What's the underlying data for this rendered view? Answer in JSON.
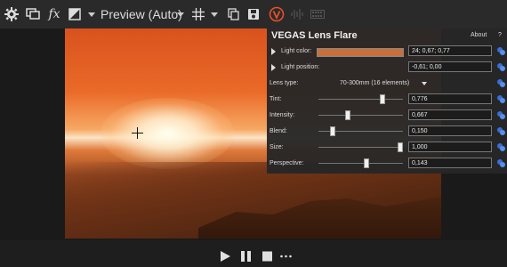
{
  "toolbar": {
    "preview_quality": "Preview (Auto)",
    "icons": [
      "gear-icon",
      "external-monitor-icon",
      "fx-icon",
      "split-screen-icon",
      "grid-overlay-icon",
      "copy-snapshot-icon",
      "save-snapshot-icon",
      "vegas-logo-icon",
      "audio-waveform-icon",
      "film-strip-icon"
    ]
  },
  "panel": {
    "title": "VEGAS Lens Flare",
    "about_label": "About",
    "help_label": "?",
    "rows": [
      {
        "label": "Light color:",
        "value": "24; 0,67; 0,77",
        "swatch": "#c7703e"
      },
      {
        "label": "Light position:",
        "value": "-0,61; 0,00"
      },
      {
        "label": "Lens type:",
        "value": "70-300mm (16 elements)"
      },
      {
        "label": "Tint:",
        "value": "0,776",
        "level": 0.776
      },
      {
        "label": "Intensity:",
        "value": "0,667",
        "level": 0.333
      },
      {
        "label": "Blend:",
        "value": "0,150",
        "level": 0.15
      },
      {
        "label": "Size:",
        "value": "1,000",
        "level": 1.0
      },
      {
        "label": "Perspective:",
        "value": "0,143",
        "level": 0.571
      }
    ]
  },
  "transport": {
    "icons": [
      "play-icon",
      "pause-icon",
      "stop-icon",
      "more-options-icon"
    ]
  }
}
